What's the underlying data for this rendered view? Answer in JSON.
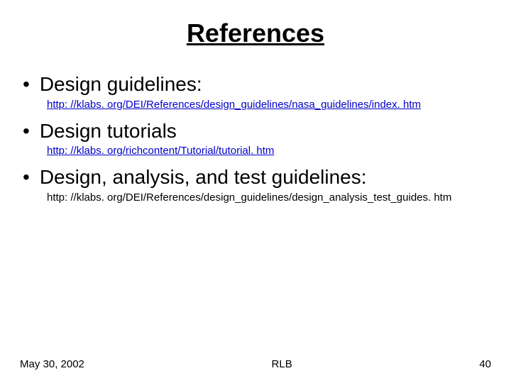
{
  "title": "References",
  "bullets": [
    {
      "label": "Design guidelines:",
      "sub": "http: //klabs. org/DEI/References/design_guidelines/nasa_guidelines/index. htm",
      "link": true
    },
    {
      "label": "Design tutorials",
      "sub": "http: //klabs. org/richcontent/Tutorial/tutorial. htm",
      "link": true
    },
    {
      "label": "Design, analysis, and test guidelines:",
      "sub": "http: //klabs. org/DEI/References/design_guidelines/design_analysis_test_guides. htm",
      "link": false
    }
  ],
  "footer": {
    "date": "May 30, 2002",
    "author": "RLB",
    "page": "40"
  }
}
